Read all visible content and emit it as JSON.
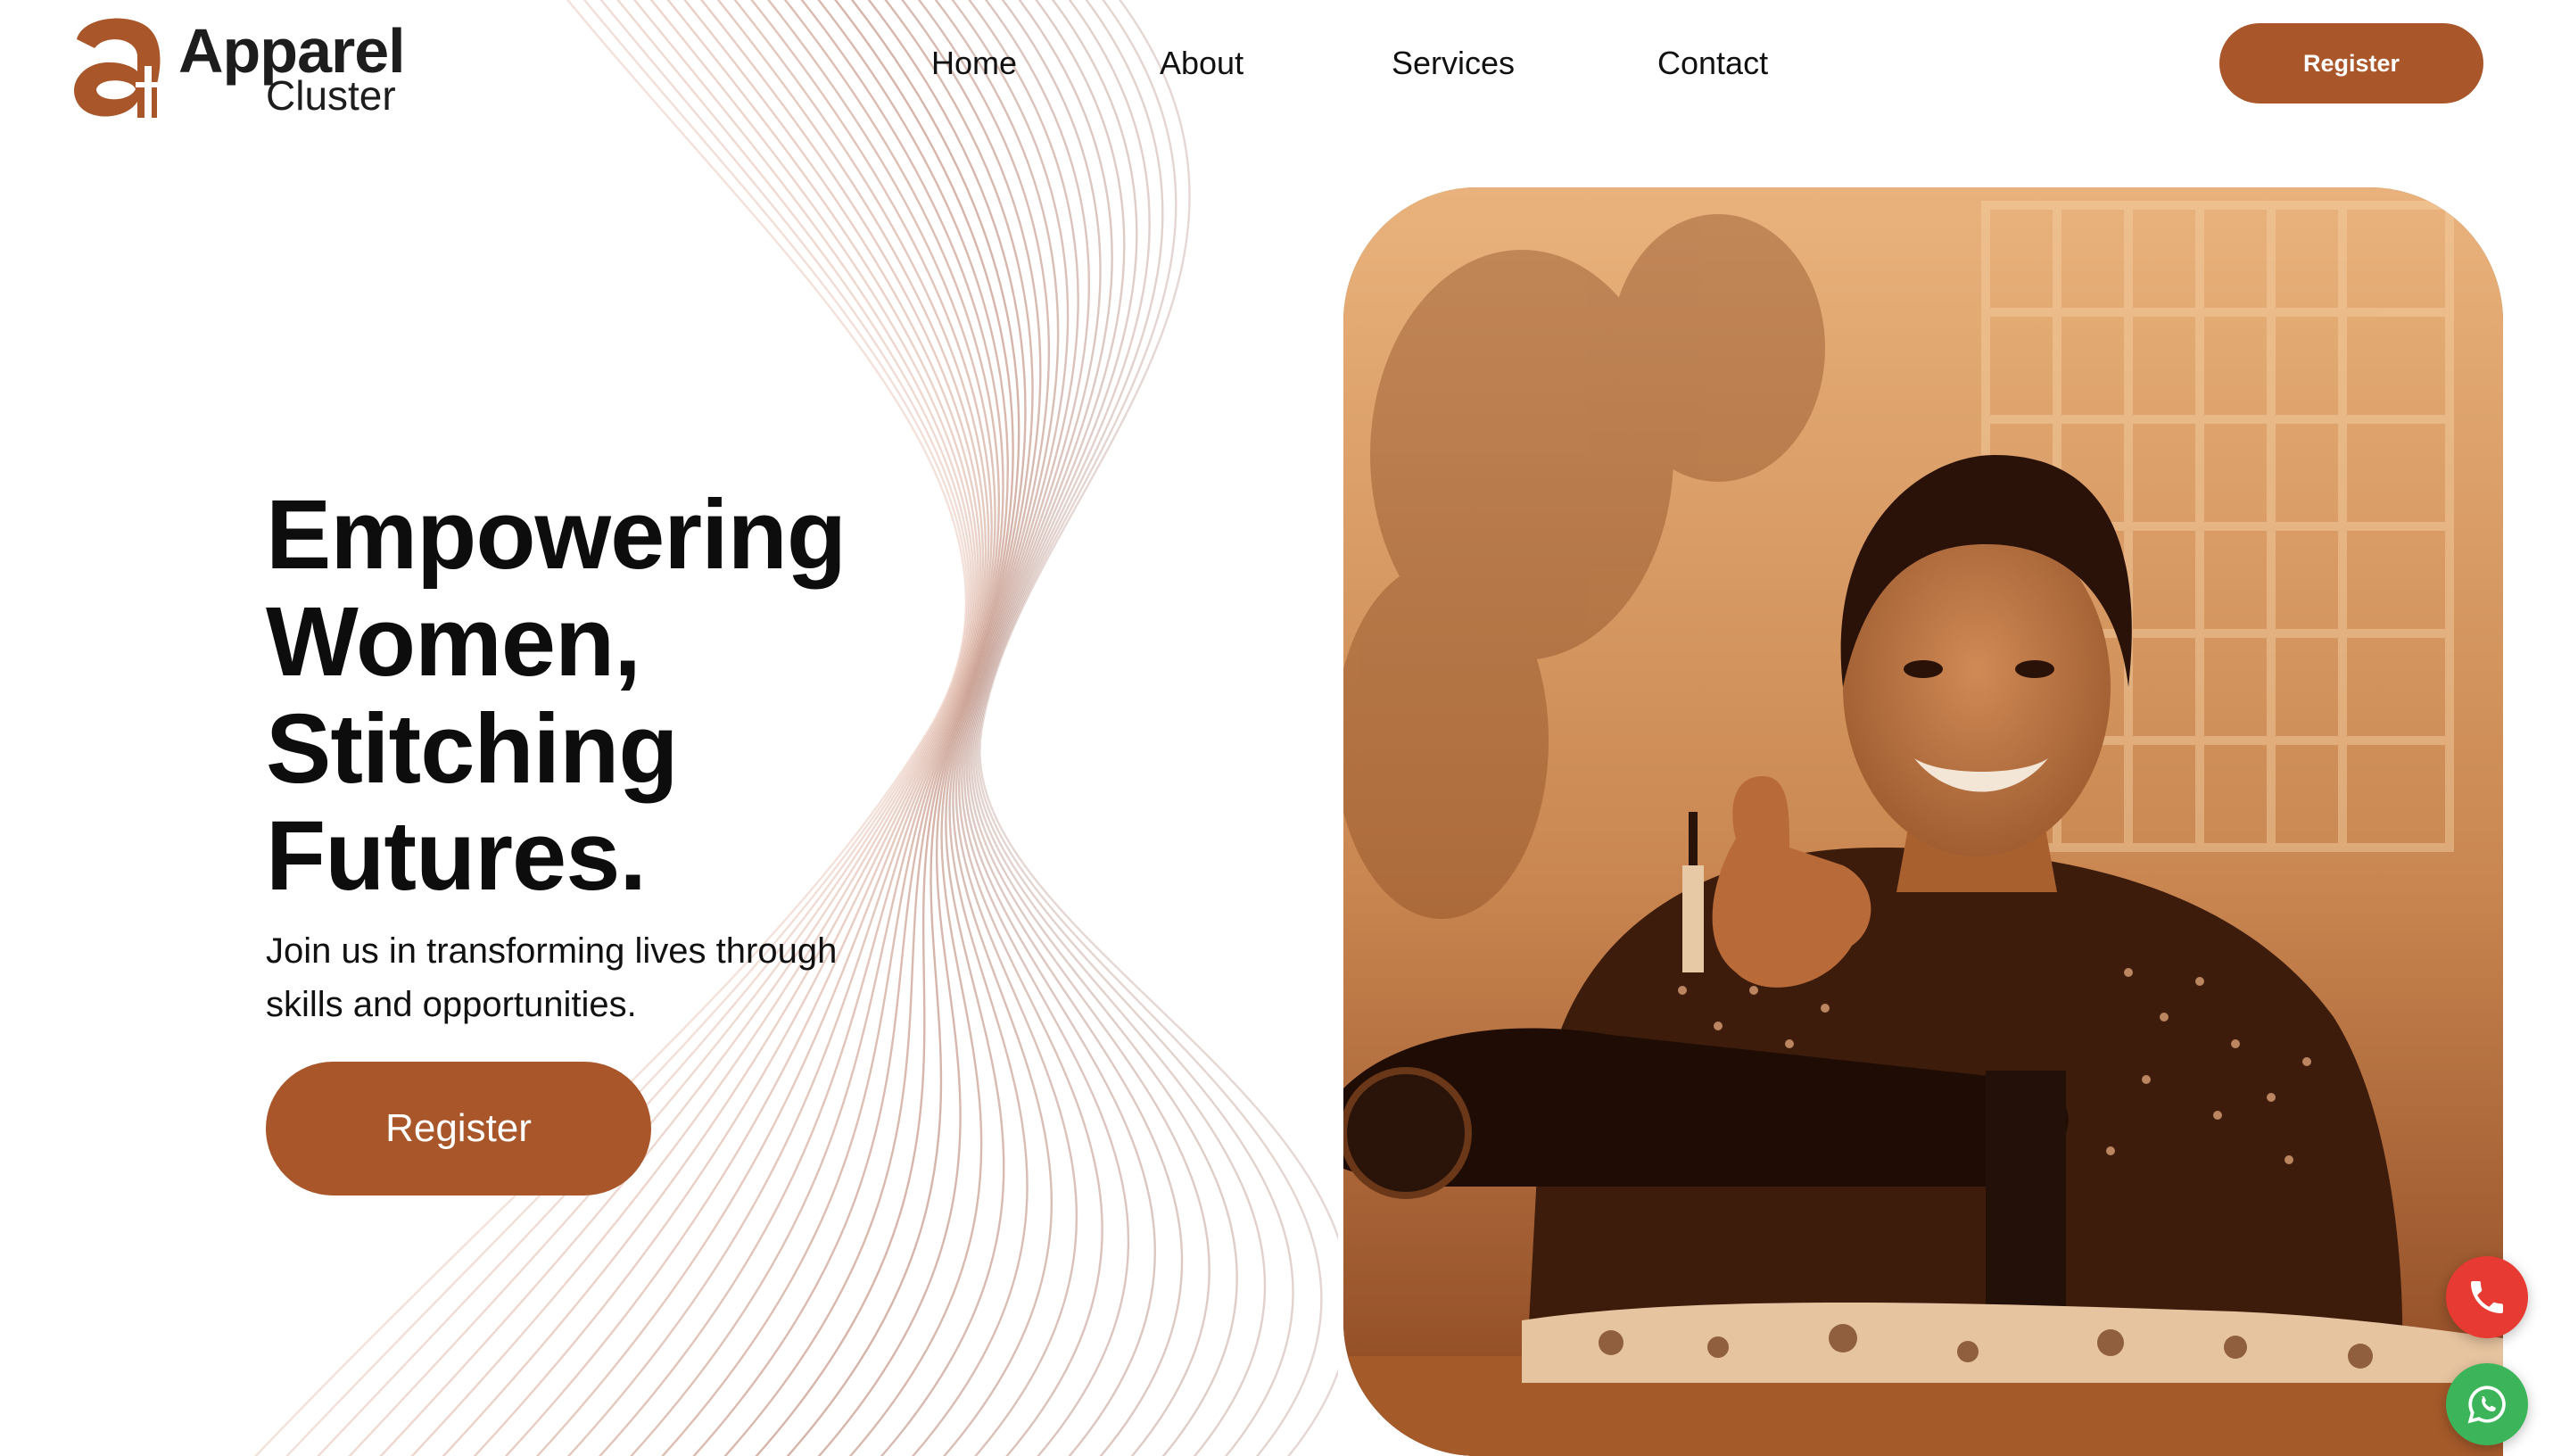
{
  "brand": {
    "name_line1": "Apparel",
    "name_line2": "Cluster",
    "accent_color": "#a9562a"
  },
  "nav": {
    "items": [
      {
        "label": "Home"
      },
      {
        "label": "About"
      },
      {
        "label": "Services"
      },
      {
        "label": "Contact"
      }
    ]
  },
  "header": {
    "register_label": "Register"
  },
  "hero": {
    "title_lines": [
      "Empowering",
      "Women,",
      "Stitching",
      "Futures."
    ],
    "subtitle_lines": [
      "Join us in transforming lives through",
      "skills and opportunities."
    ],
    "register_label": "Register",
    "image_icon": "woman-at-sewing-machine-photo"
  },
  "floating": {
    "phone_icon": "phone-icon",
    "phone_color": "#e63a32",
    "whatsapp_icon": "whatsapp-icon",
    "whatsapp_color": "#3cb55a"
  }
}
